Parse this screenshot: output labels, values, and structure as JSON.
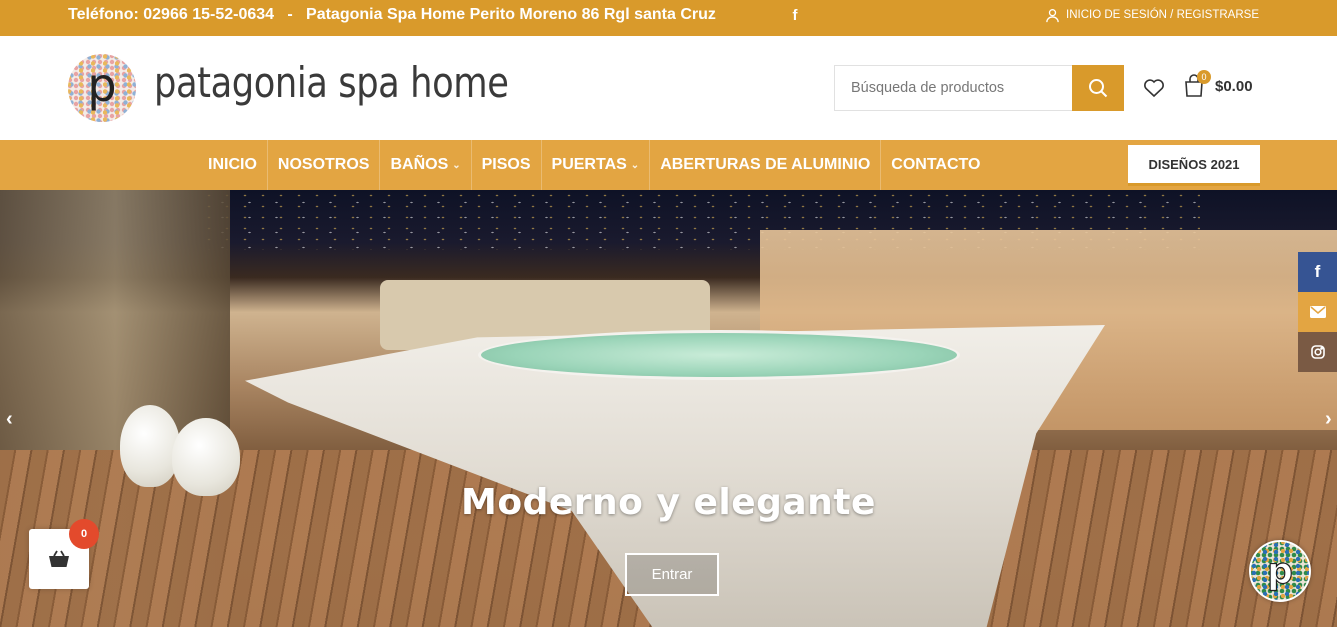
{
  "topbar": {
    "contact": "Teléfono: 02966 15-52-0634   -   Patagonia Spa Home Perito Moreno 86 Rgl santa Cruz",
    "facebook_glyph": "f",
    "login_label": "INICIO DE SESIÓN / REGISTRARSE",
    "bg_color": "#d99a2b"
  },
  "header": {
    "logo_letter": "p",
    "logo_text": "patagonia spa home",
    "search": {
      "placeholder": "Búsqueda de productos"
    },
    "cart": {
      "count": "0",
      "total": "$0.00"
    }
  },
  "nav": {
    "items": [
      {
        "label": "INICIO",
        "dropdown": false
      },
      {
        "label": "NOSOTROS",
        "dropdown": false
      },
      {
        "label": "BAÑOS",
        "dropdown": true
      },
      {
        "label": "PISOS",
        "dropdown": false
      },
      {
        "label": "PUERTAS",
        "dropdown": true
      },
      {
        "label": "ABERTURAS DE ALUMINIO",
        "dropdown": false
      },
      {
        "label": "CONTACTO",
        "dropdown": false
      }
    ],
    "designs_button": "DISEÑOS 2021",
    "bg_color": "#e3a542"
  },
  "hero": {
    "headline": "Moderno y elegante",
    "cta": "Entrar",
    "prev_glyph": "‹",
    "next_glyph": "›"
  },
  "social": {
    "facebook_glyph": "f",
    "icons": [
      "facebook-icon",
      "mail-icon",
      "instagram-icon"
    ]
  },
  "floating_cart": {
    "count": "0"
  }
}
